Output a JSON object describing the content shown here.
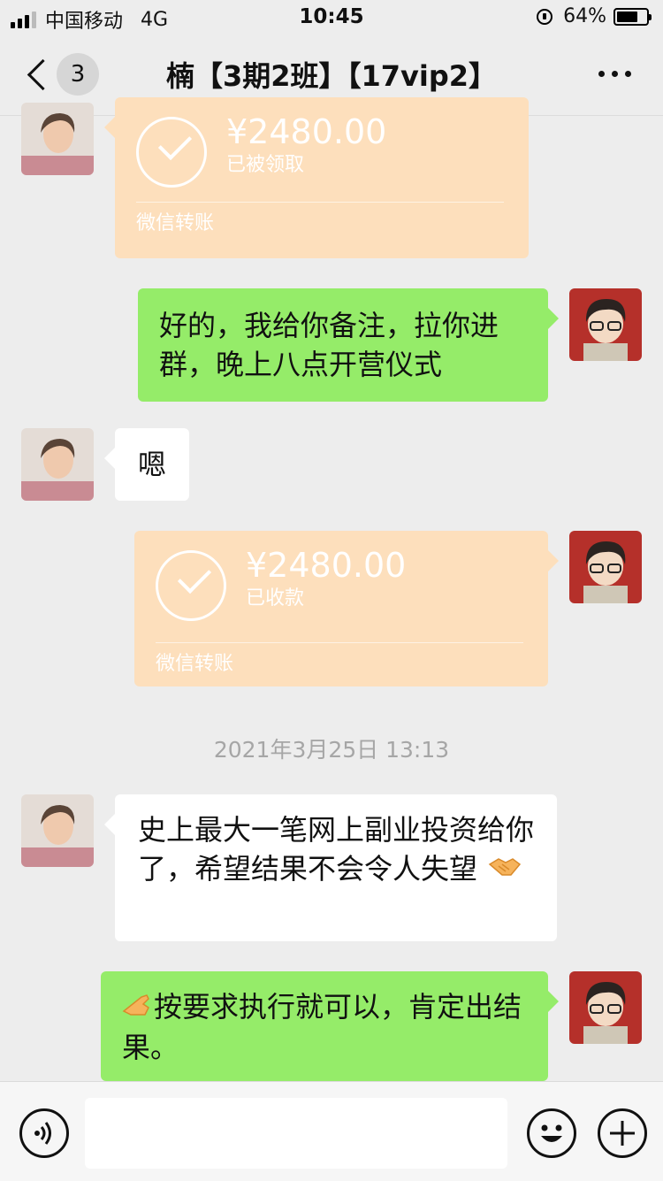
{
  "status_bar": {
    "carrier": "中国移动",
    "network": "4G",
    "time": "10:45",
    "battery": "64%",
    "battery_level": 0.64
  },
  "header": {
    "unread_count": "3",
    "title": "楠【3期2班】【17vip2】"
  },
  "messages": [
    {
      "kind": "transfer",
      "sender": "contact",
      "amount": "¥2480.00",
      "status": "已被领取",
      "footer": "微信转账"
    },
    {
      "kind": "text",
      "sender": "me",
      "text": "好的，我给你备注，拉你进群，晚上八点开营仪式"
    },
    {
      "kind": "text",
      "sender": "contact",
      "text": "嗯"
    },
    {
      "kind": "transfer",
      "sender": "me",
      "amount": "¥2480.00",
      "status": "已收款",
      "footer": "微信转账"
    },
    {
      "kind": "timestamp",
      "text": "2021年3月25日 13:13"
    },
    {
      "kind": "text",
      "sender": "contact",
      "text": "史上最大一笔网上副业投资给你了，希望结果不会令人失望",
      "emoji": "handshake-emoji"
    },
    {
      "kind": "text",
      "sender": "me",
      "text": "按要求执行就可以，肯定出结果。",
      "emoji": "pointing-hand-emoji"
    }
  ],
  "input_bar": {
    "voice_icon": "voice-icon",
    "emoji_icon": "smiley-icon",
    "plus_icon": "plus-icon",
    "value": ""
  },
  "colors": {
    "background": "#ededed",
    "my_bubble": "#95ec69",
    "contact_bubble": "#ffffff",
    "transfer_card": "#fddfbc",
    "timestamp_text": "#a6a6a6"
  }
}
